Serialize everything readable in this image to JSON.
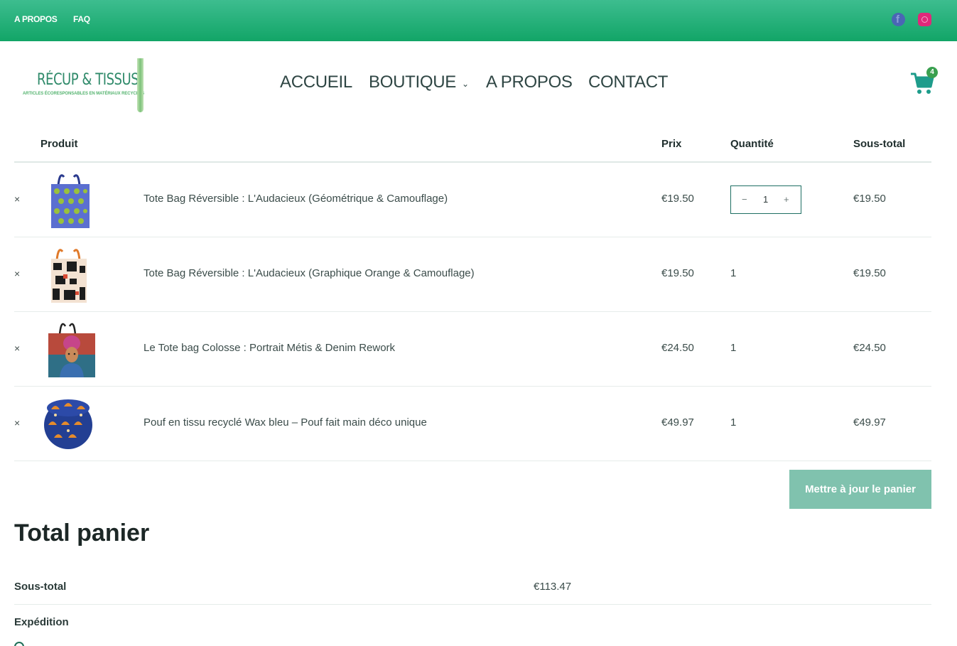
{
  "topbar": {
    "links": [
      "A PROPOS",
      "FAQ"
    ],
    "social_icons": [
      "facebook-icon",
      "instagram-icon"
    ]
  },
  "header": {
    "logo_title": "RÉCUP & TISSUS",
    "logo_tagline": "ARTICLES ÉCORESPONSABLES EN MATÉRIAUX RECYCLÉS",
    "nav": [
      "ACCUEIL",
      "BOUTIQUE",
      "A PROPOS",
      "CONTACT"
    ],
    "cart_count": "4"
  },
  "cart_table": {
    "headers": [
      "Produit",
      "Prix",
      "Quantité",
      "Sous-total"
    ],
    "remove_symbol": "×",
    "rows": [
      {
        "name": "Tote Bag Réversible : L'Audacieux (Géométrique & Camouflage)",
        "price": "€19.50",
        "qty": "1",
        "subtotal": "€19.50"
      },
      {
        "name": "Tote Bag Réversible : L'Audacieux (Graphique Orange & Camouflage)",
        "price": "€19.50",
        "qty": "1",
        "subtotal": "€19.50"
      },
      {
        "name": "Le Tote bag Colosse : Portrait Métis & Denim Rework",
        "price": "€24.50",
        "qty": "1",
        "subtotal": "€24.50"
      },
      {
        "name": "Pouf en tissu recyclé Wax bleu – Pouf fait main déco unique",
        "price": "€49.97",
        "qty": "1",
        "subtotal": "€49.97"
      }
    ],
    "stepper": {
      "minus": "−",
      "plus": "+"
    },
    "update_button": "Mettre à jour le panier"
  },
  "totals": {
    "title": "Total panier",
    "subtotal_label": "Sous-total",
    "subtotal_value": "€113.47",
    "shipping_label": "Expédition"
  },
  "colors": {
    "topbar": "#12a567",
    "accent": "#1e6f63",
    "button": "#80c2ae",
    "badge": "#3aa04f"
  }
}
